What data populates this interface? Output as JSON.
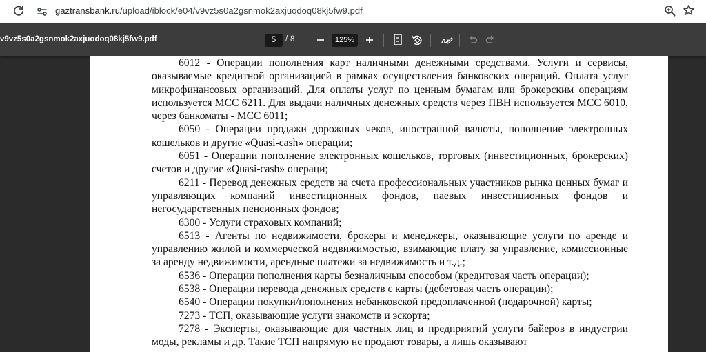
{
  "browser": {
    "url_host": "gaztransbank.ru",
    "url_path": "/upload/iblock/e04/v9vz5s0a2gsnmok2axjuodoq08kj5fw9.pdf"
  },
  "pdf_toolbar": {
    "title": "v9vz5s0a2gsnmok2axjuodoq08kj5fw9.pdf",
    "current_page": "5",
    "page_separator": "/",
    "total_pages": "8",
    "zoom": "125%"
  },
  "document": {
    "paragraphs": [
      "6012 - Операции пополнения карт наличными денежными средствами. Услуги и сервисы, оказываемые кредитной организацией в рамках осуществления банковских операций. Оплата услуг микрофинансовых организаций. Для оплаты услуг по ценным бумагам или брокерским операциям используется МСС 6211. Для выдачи наличных денежных средств через ПВН используется МСС 6010, через банкоматы - МСС 6011;",
      "6050 - Операции продажи дорожных чеков, иностранной валюты, пополнение электронных кошельков и другие «Quasi-cash» операции;",
      "6051 - Операции пополнение электронных кошельков, торговых (инвестиционных, брокерских) счетов и другие «Quasi-cash» операци;",
      "6211 - Перевод денежных средств на счета профессиональных участников рынка ценных бумаг и управляющих компаний инвестиционных фондов, паевых инвестиционных фондов и негосударственных пенсионных фондов;",
      "6300 - Услуги страховых компаний;",
      "6513 - Агенты по недвижимости, брокеры и менеджеры, оказывающие услуги по аренде и управлению жилой и коммерческой недвижимостью, взимающие плату за управление, комиссионные за аренду недвижимости, арендные платежи за недвижимость и т.д.;",
      "6536 - Операции пополнения карты безналичным способом (кредитовая часть операции);",
      "6538 - Операции перевода денежных средств с карты (дебетовая часть операции);",
      "6540 - Операции покупки/пополнения небанковской предоплаченной (подарочной) карты;",
      "7273 - ТСП, оказывающие услуги знакомств и эскорта;",
      "7278 - Эксперты, оказывающие для частных лиц и предприятий услуги байеров в индустрии моды, рекламы и др. Такие ТСП напрямую не продают товары, а лишь оказывают"
    ]
  },
  "icons": {
    "reload": "reload-icon",
    "site_info": "site-info-icon",
    "zoom": "zoom-icon",
    "bookmark": "star-icon",
    "fit": "fit-page-icon",
    "rotate": "rotate-icon",
    "annotate": "annotate-icon",
    "undo": "undo-icon",
    "redo": "redo-icon"
  }
}
